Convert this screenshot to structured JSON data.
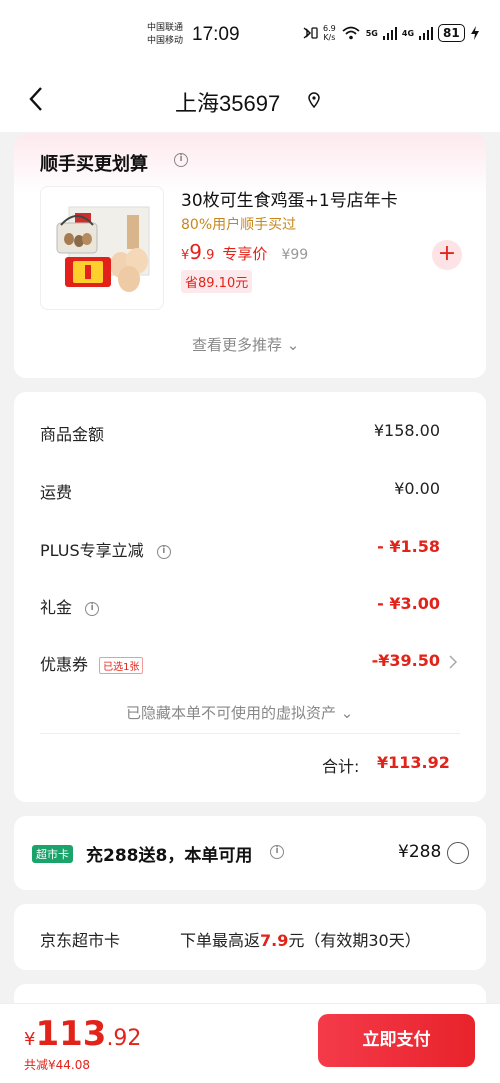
{
  "status_bar": {
    "carrier_1": "中国联通",
    "carrier_2": "中国移动",
    "time": "17:09",
    "net_speed_value": "6.9",
    "net_speed_unit": "K/s",
    "signal_1": "5G",
    "signal_2": "4G",
    "battery": "81"
  },
  "nav": {
    "title": "上海35697"
  },
  "recommend": {
    "title": "顺手买更划算",
    "product_name": "30枚可生食鸡蛋+1号店年卡",
    "product_sub": "80%用户顺手买过",
    "price_symbol": "¥",
    "price_int": "9",
    "price_dec": ".9",
    "price_tag": "专享价",
    "original_price": "¥99",
    "save_text": "省89.10元",
    "add_label": "+",
    "more_label": "查看更多推荐 ⌄"
  },
  "summary": {
    "rows": [
      {
        "label": "商品金额",
        "value": "¥158.00"
      },
      {
        "label": "运费",
        "value": "¥0.00"
      },
      {
        "label": "PLUS专享立减",
        "value": "- ¥1.58"
      },
      {
        "label": "礼金",
        "value": "- ¥3.00"
      },
      {
        "label": "优惠券",
        "badge": "已选1张",
        "value": "-¥39.50"
      }
    ],
    "hidden_assets": "已隐藏本单不可使用的虚拟资产 ⌄",
    "total_label": "合计:",
    "total_value": "¥113.92"
  },
  "market_card": {
    "badge": "超市卡",
    "text": "充288送8，本单可用",
    "price": "¥288"
  },
  "card_info": {
    "label": "京东超市卡",
    "text_before": "下单最高返",
    "highlight": "7.9",
    "text_after": "元（有效期30天）"
  },
  "footer": {
    "price_symbol": "¥",
    "price_int": "113",
    "price_dec": ".92",
    "saved": "共减¥44.08",
    "pay_label": "立即支付"
  },
  "colors": {
    "accent": "#e2231a",
    "market_badge": "#1aa36b",
    "recommend_sub": "#c8871d"
  }
}
